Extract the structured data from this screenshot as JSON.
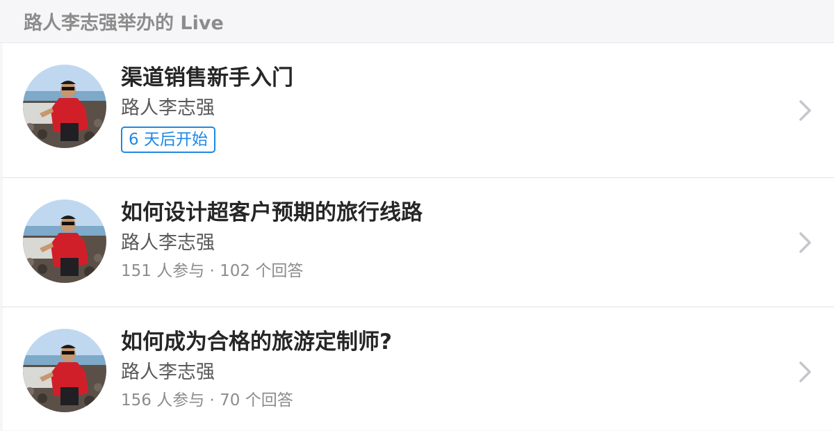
{
  "section": {
    "title": "路人李志强举办的 Live"
  },
  "items": [
    {
      "title": "渠道销售新手入门",
      "speaker": "路人李志强",
      "badge": "6 天后开始"
    },
    {
      "title": "如何设计超客户预期的旅行线路",
      "speaker": "路人李志强",
      "meta": "151 人参与 · 102 个回答"
    },
    {
      "title": "如何成为合格的旅游定制师?",
      "speaker": "路人李志强",
      "meta": "156 人参与 · 70 个回答"
    }
  ],
  "icons": {
    "chevron": "chevron-right-icon",
    "avatar": "avatar-photo"
  },
  "colors": {
    "badge_blue": "#1e88e5",
    "chevron": "#c5c5cc",
    "title": "#262626",
    "muted": "#8c8c8c"
  }
}
